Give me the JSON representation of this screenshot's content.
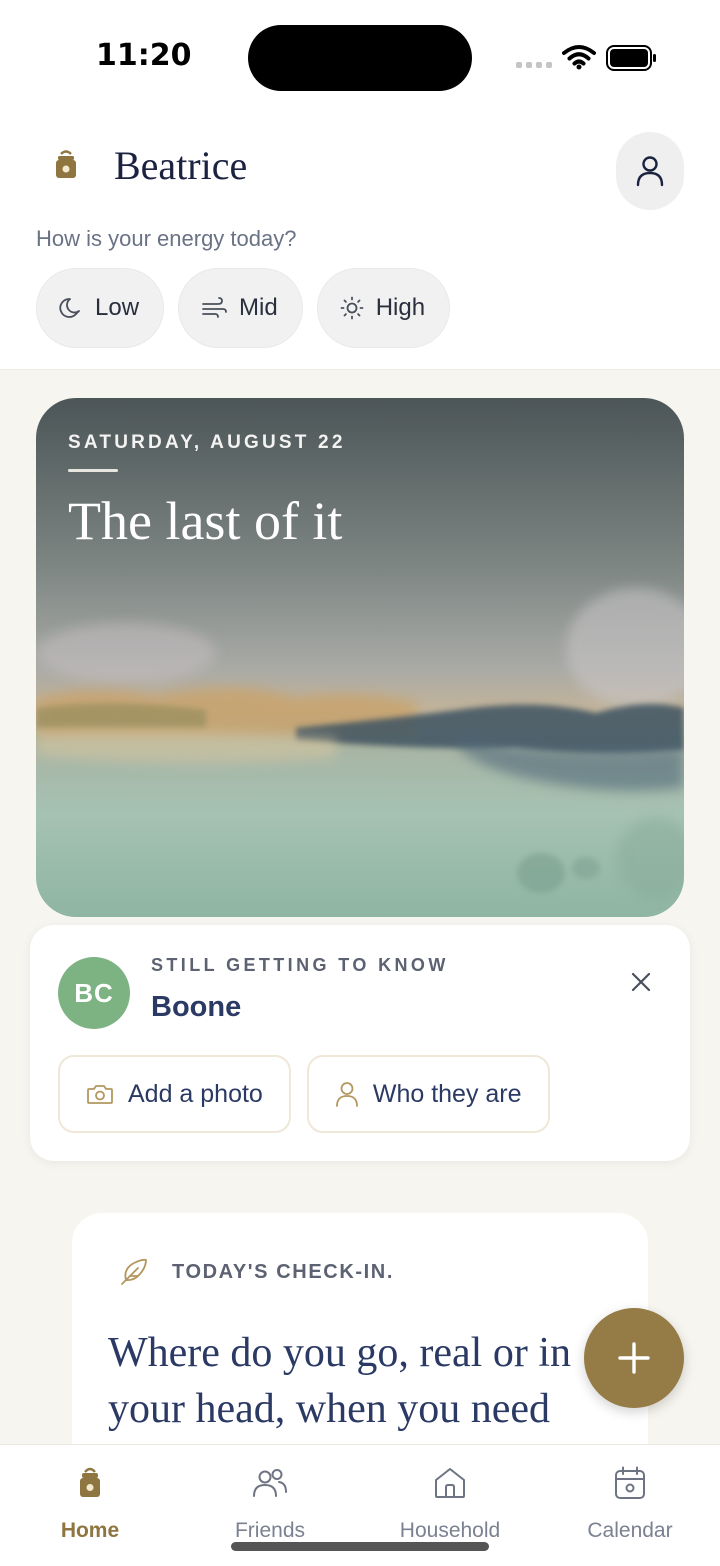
{
  "status_bar": {
    "time": "11:20"
  },
  "header": {
    "user_name": "Beatrice",
    "energy_question": "How is your energy today?",
    "energy_options": [
      {
        "label": "Low",
        "icon": "moon-icon"
      },
      {
        "label": "Mid",
        "icon": "wind-icon"
      },
      {
        "label": "High",
        "icon": "sun-icon"
      }
    ]
  },
  "hero": {
    "date": "SATURDAY, AUGUST 22",
    "title": "The last of it"
  },
  "getting_to_know": {
    "kicker": "STILL GETTING TO KNOW",
    "initials": "BC",
    "name": "Boone",
    "avatar_color": "#7db383",
    "actions": [
      {
        "label": "Add a photo",
        "icon": "camera-icon"
      },
      {
        "label": "Who they are",
        "icon": "person-icon"
      }
    ]
  },
  "checkin": {
    "kicker": "TODAY'S CHECK-IN.",
    "question_line1": "Where do you go, real or in",
    "question_line2": "your head, when you need"
  },
  "nav": {
    "items": [
      {
        "label": "Home",
        "icon": "lantern-icon",
        "active": true
      },
      {
        "label": "Friends",
        "icon": "people-icon",
        "active": false
      },
      {
        "label": "Household",
        "icon": "house-icon",
        "active": false
      },
      {
        "label": "Calendar",
        "icon": "calendar-icon",
        "active": false
      }
    ]
  },
  "colors": {
    "accent": "#957b45",
    "text_navy": "#2b3a64",
    "background": "#f7f5ef"
  }
}
